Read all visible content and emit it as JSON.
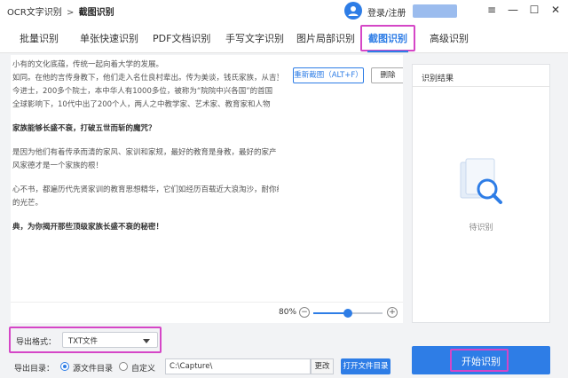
{
  "app": {
    "title": "OCR文字识别",
    "crumb_sep": ">",
    "crumb_current": "截图识别",
    "login_label": "登录/注册",
    "window_controls": {
      "menu": "≡",
      "minimize": "—",
      "maximize": "☐",
      "close": "✕"
    }
  },
  "tabs": [
    {
      "label": "批量识别",
      "active": false
    },
    {
      "label": "单张快速识别",
      "active": false
    },
    {
      "label": "PDF文档识别",
      "active": false
    },
    {
      "label": "手写文字识别",
      "active": false
    },
    {
      "label": "图片局部识别",
      "active": false
    },
    {
      "label": "截图识别",
      "active": true
    },
    {
      "label": "高级识别",
      "active": false
    }
  ],
  "preview": {
    "rescreen_button": "重新截图（ALT+F）",
    "delete_button": "删除",
    "lines": [
      {
        "text": "小有的文化底蕴，传统一起向着大学的发展。",
        "bold": false
      },
      {
        "text": "如同。在他的言传身教下，他们走入名仕良村辈出。传为美谈，钱氏家族，从吉至",
        "bold": false
      },
      {
        "text": "今进士，200多个院士，本中华人有1000多位，被称为“院院中兴各国”的首国",
        "bold": false
      },
      {
        "text": "全球影响下，10代中出了200个人，两人之中教学家、艺术家、教育家和人物",
        "bold": false
      },
      {
        "text": "",
        "bold": false
      },
      {
        "text": "家族能够长盛不衰，打破五世而斩的魔咒？",
        "bold": true
      },
      {
        "text": "",
        "bold": false
      },
      {
        "text": "是因为他们有着传承而清的家风、家训和家规，最好的教育是身教，最好的家产",
        "bold": false
      },
      {
        "text": "风家德才是一个家族的根！",
        "bold": false
      },
      {
        "text": "",
        "bold": false
      },
      {
        "text": "心不书，都遍历代先贤家训的教育思想精华，它们如经历百载近大浪淘沙，耐你终",
        "bold": false
      },
      {
        "text": "的光芒。",
        "bold": false
      },
      {
        "text": "",
        "bold": false
      },
      {
        "text": "典，为你揭开那些顶级家族长盛不衰的秘密！",
        "bold": true
      }
    ]
  },
  "zoom": {
    "percent_label": "80%",
    "minus": "⊖",
    "plus": "⊕",
    "level": 0.5
  },
  "result": {
    "title": "识别结果",
    "status": "待识别"
  },
  "export": {
    "format_label": "导出格式：",
    "format_value": "TXT文件",
    "dir_label": "导出目录：",
    "option_source": "源文件目录",
    "option_custom": "自定义",
    "selected_option": "source",
    "path_value": "C:\\Capture\\",
    "change_button": "更改",
    "open_folder_button": "打开文件目录"
  },
  "start_button": "开始识别",
  "colors": {
    "accent": "#2e7de6",
    "highlight": "#d546c7",
    "panel_bg": "#f2f3f5"
  }
}
